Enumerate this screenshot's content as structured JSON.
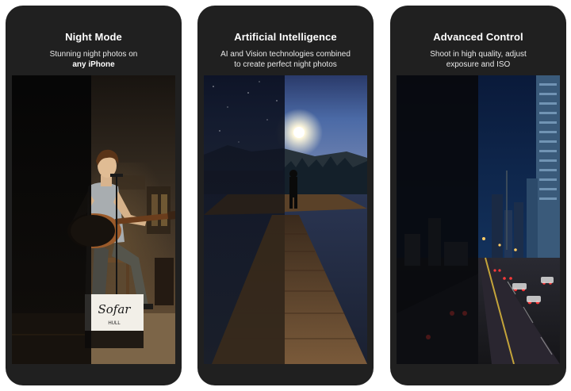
{
  "cards": [
    {
      "title": "Night Mode",
      "subtitle_line1": "Stunning night photos on",
      "subtitle_line2": "any iPhone",
      "sign_text": "Sofar",
      "sign_subtext": "HULL"
    },
    {
      "title": "Artificial Intelligence",
      "subtitle_line1": "AI and Vision technologies combined",
      "subtitle_line2": "to create perfect night photos"
    },
    {
      "title": "Advanced Control",
      "subtitle_line1": "Shoot in high quality, adjust",
      "subtitle_line2": "exposure and ISO"
    }
  ]
}
